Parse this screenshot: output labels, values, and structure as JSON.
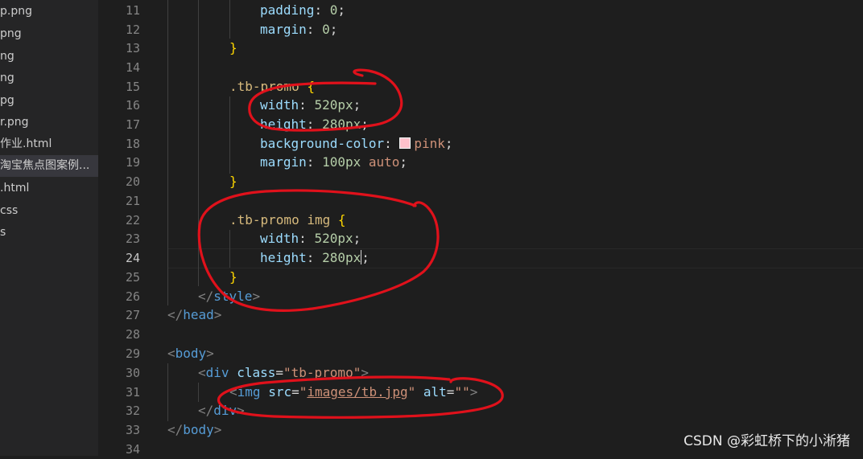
{
  "sidebar": {
    "files": [
      {
        "name": "p.png"
      },
      {
        "name": "png"
      },
      {
        "name": "ng"
      },
      {
        "name": "ng"
      },
      {
        "name": "pg"
      },
      {
        "name": "r.png"
      },
      {
        "name": "作业.html"
      },
      {
        "name": "淘宝焦点图案例...",
        "selected": true
      },
      {
        "name": ".html"
      },
      {
        "name": "css"
      },
      {
        "name": "s"
      }
    ]
  },
  "editor": {
    "line_numbers": [
      "11",
      "12",
      "13",
      "14",
      "15",
      "16",
      "17",
      "18",
      "19",
      "20",
      "21",
      "22",
      "23",
      "24",
      "25",
      "26",
      "27",
      "28",
      "29",
      "30",
      "31",
      "32",
      "33",
      "34"
    ],
    "active_line": "24",
    "code": {
      "l11": {
        "prop": "padding",
        "colon": ": ",
        "val": "0",
        "semi": ";"
      },
      "l12": {
        "prop": "margin",
        "colon": ": ",
        "val": "0",
        "semi": ";"
      },
      "l13": {
        "brace": "}"
      },
      "l15": {
        "selector": ".tb-promo",
        "brace": " {"
      },
      "l16": {
        "prop": "width",
        "colon": ": ",
        "val": "520px",
        "semi": ";"
      },
      "l17": {
        "prop": "height",
        "colon": ": ",
        "val": "280px",
        "semi": ";"
      },
      "l18": {
        "prop": "background-color",
        "colon": ": ",
        "val": "pink",
        "semi": ";"
      },
      "l19": {
        "prop": "margin",
        "colon": ": ",
        "val": "100px",
        "val2": "auto",
        "semi": ";"
      },
      "l20": {
        "brace": "}"
      },
      "l22": {
        "selector": ".tb-promo img",
        "brace": " {"
      },
      "l23": {
        "prop": "width",
        "colon": ": ",
        "val": "520px",
        "semi": ";"
      },
      "l24": {
        "prop": "height",
        "colon": ": ",
        "val": "280px",
        "semi": ";"
      },
      "l25": {
        "brace": "}"
      },
      "l26": {
        "open": "</",
        "tag": "style",
        "close": ">"
      },
      "l27": {
        "open": "</",
        "tag": "head",
        "close": ">"
      },
      "l29": {
        "open": "<",
        "tag": "body",
        "close": ">"
      },
      "l30": {
        "open": "<",
        "tag": "div",
        "attr": "class",
        "eq": "=",
        "val": "\"tb-promo\"",
        "close": ">"
      },
      "l31": {
        "open": "<",
        "tag": "img",
        "attr1": "src",
        "eq1": "=",
        "q1": "\"",
        "val1": "images/tb.jpg",
        "q2": "\"",
        "attr2": "alt",
        "eq2": "=",
        "val2": "\"\"",
        "close": ">"
      },
      "l32": {
        "open": "</",
        "tag": "div",
        "close": ">"
      },
      "l33": {
        "open": "</",
        "tag": "body",
        "close": ">"
      }
    }
  },
  "watermark": "CSDN @彩虹桥下的小淅猪",
  "colors": {
    "background": "#1e1e1e",
    "sidebar": "#252526",
    "annotation": "#e0111b"
  }
}
